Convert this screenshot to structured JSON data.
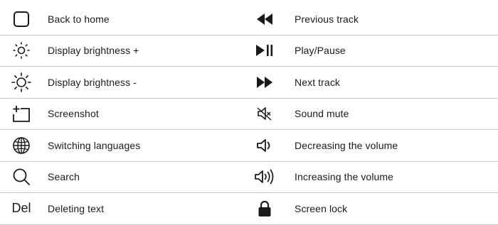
{
  "left": [
    {
      "icon": "square-outline-icon",
      "label": "Back to home"
    },
    {
      "icon": "brightness-up-icon",
      "label": "Display brightness +"
    },
    {
      "icon": "brightness-down-icon",
      "label": "Display brightness -"
    },
    {
      "icon": "screenshot-icon",
      "label": "Screenshot"
    },
    {
      "icon": "globe-icon",
      "label": "Switching languages"
    },
    {
      "icon": "search-icon",
      "label": "Search"
    },
    {
      "icon": "del-key-icon",
      "icon_text": "Del",
      "label": "Deleting text"
    }
  ],
  "right": [
    {
      "icon": "previous-track-icon",
      "label": "Previous track"
    },
    {
      "icon": "play-pause-icon",
      "label": "Play/Pause"
    },
    {
      "icon": "next-track-icon",
      "label": "Next track"
    },
    {
      "icon": "mute-icon",
      "label": "Sound mute"
    },
    {
      "icon": "volume-down-icon",
      "label": "Decreasing the volume"
    },
    {
      "icon": "volume-up-icon",
      "label": "Increasing the volume"
    },
    {
      "icon": "lock-icon",
      "label": "Screen lock"
    }
  ],
  "colors": {
    "text": "#1a1a1a",
    "divider": "#c8c8c8"
  }
}
